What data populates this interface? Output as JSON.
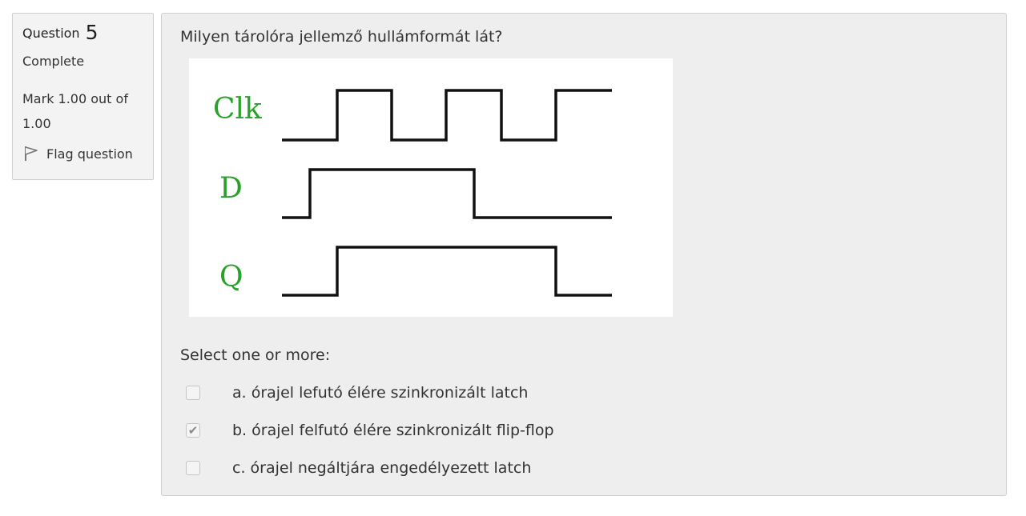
{
  "info": {
    "question_label": "Question",
    "question_number": "5",
    "state": "Complete",
    "grade": "Mark 1.00 out of 1.00",
    "flag_label": "Flag question"
  },
  "question": {
    "text": "Milyen tárolóra jellemző hullámformát lát?",
    "figure": {
      "signals": [
        "Clk",
        "D",
        "Q"
      ],
      "label_color": "#2aa12a"
    }
  },
  "answer": {
    "prompt": "Select one or more:",
    "options": [
      {
        "label": "a. órajel lefutó élére szinkronizált latch",
        "checked": false
      },
      {
        "label": "b. órajel felfutó élére szinkronizált flip-flop",
        "checked": true
      },
      {
        "label": "c. órajel negáltjára engedélyezett latch",
        "checked": false
      }
    ]
  }
}
